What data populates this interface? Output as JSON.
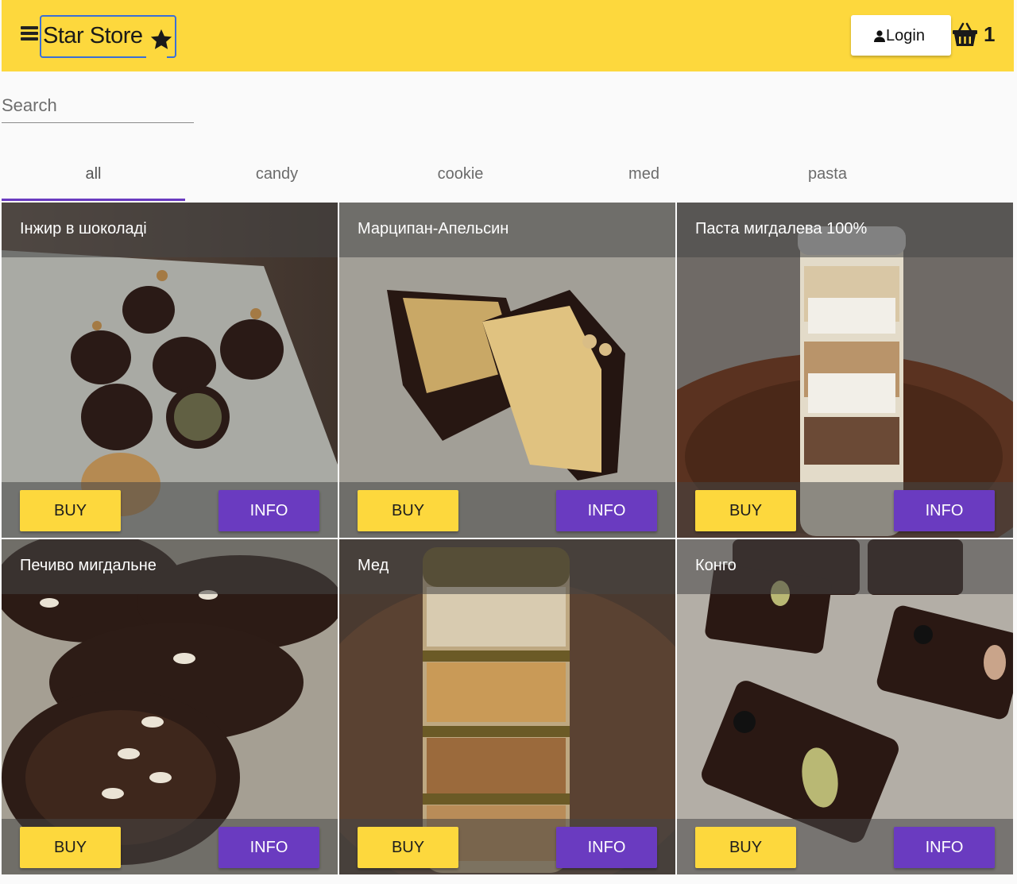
{
  "header": {
    "logo_text": "Star Store",
    "login_label": "Login",
    "cart_count": "1",
    "accent_color": "#fdd83d"
  },
  "search": {
    "placeholder": "Search",
    "value": ""
  },
  "tabs": [
    {
      "label": "all",
      "active": true
    },
    {
      "label": "candy"
    },
    {
      "label": "cookie"
    },
    {
      "label": "med"
    },
    {
      "label": "pasta"
    }
  ],
  "products": [
    {
      "title": "Інжир в шоколаді",
      "buy_label": "BUY",
      "info_label": "INFO"
    },
    {
      "title": "Марципан-Апельсин",
      "buy_label": "BUY",
      "info_label": "INFO"
    },
    {
      "title": "Паста мигдалева 100%",
      "buy_label": "BUY",
      "info_label": "INFO"
    },
    {
      "title": "Печиво мигдальне",
      "buy_label": "BUY",
      "info_label": "INFO"
    },
    {
      "title": "Мед",
      "buy_label": "BUY",
      "info_label": "INFO"
    },
    {
      "title": "Конго",
      "buy_label": "BUY",
      "info_label": "INFO"
    }
  ],
  "colors": {
    "buy": "#fdd83d",
    "info": "#6a3bc0",
    "tab_indicator": "#6a3bc0"
  },
  "icons": {
    "menu": "menu-icon",
    "star": "star-icon",
    "user": "user-icon",
    "cart": "basket-icon"
  }
}
